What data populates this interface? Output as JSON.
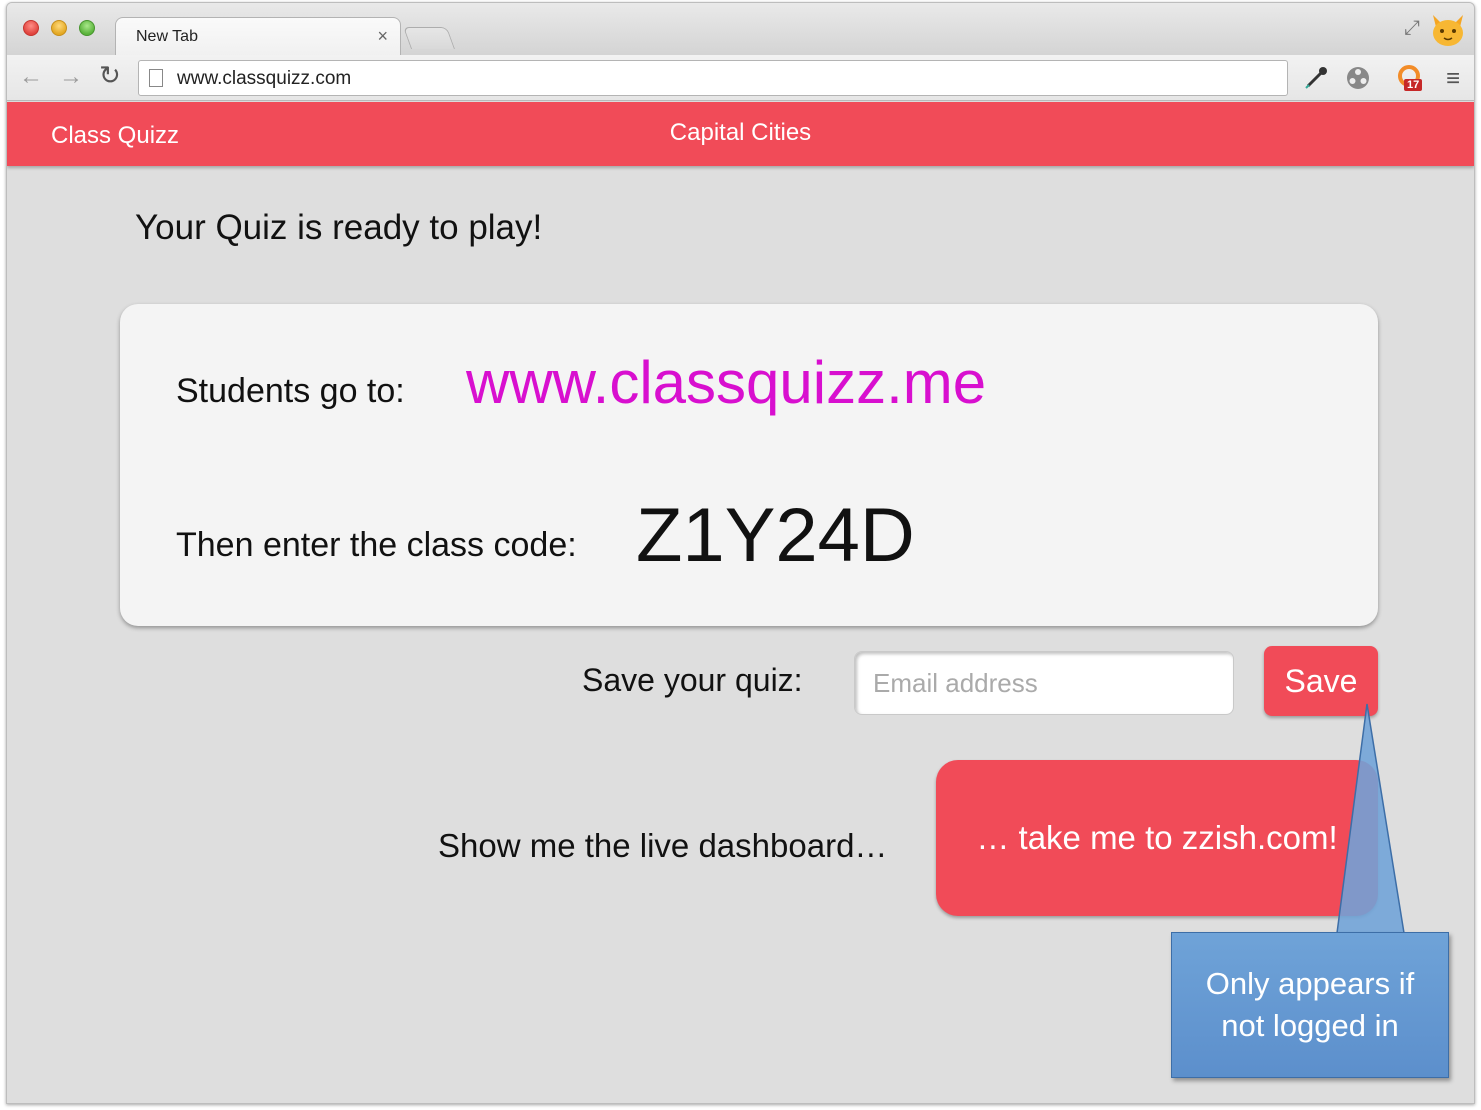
{
  "browser": {
    "tab_title": "New Tab",
    "tab_close": "×",
    "url": "www.classquizz.com",
    "extension_badge_count": "17"
  },
  "icons": {
    "back": "back-arrow-icon",
    "forward": "forward-arrow-icon",
    "reload": "reload-icon",
    "page": "page-icon",
    "menu": "hamburger-menu-icon",
    "fullscreen": "fullscreen-icon",
    "profile": "cat-avatar-icon"
  },
  "app": {
    "brand": "Class Quizz",
    "quiz_title": "Capital Cities",
    "ready_message": "Your Quiz is ready to play!",
    "students_label": "Students go to:",
    "students_url": "www.classquizz.me",
    "code_label": "Then enter the class code:",
    "class_code": "Z1Y24D",
    "save_label": "Save your quiz:",
    "email_placeholder": "Email address",
    "save_button": "Save",
    "dashboard_label": "Show me the live dashboard…",
    "zzish_button": "… take me to zzish.com!"
  },
  "annotation": {
    "callout_text": "Only appears if not logged in"
  },
  "colors": {
    "brand_red": "#f14b58",
    "url_magenta": "#d80fcf",
    "callout_blue": "#6599d3",
    "page_background": "#dedede"
  }
}
